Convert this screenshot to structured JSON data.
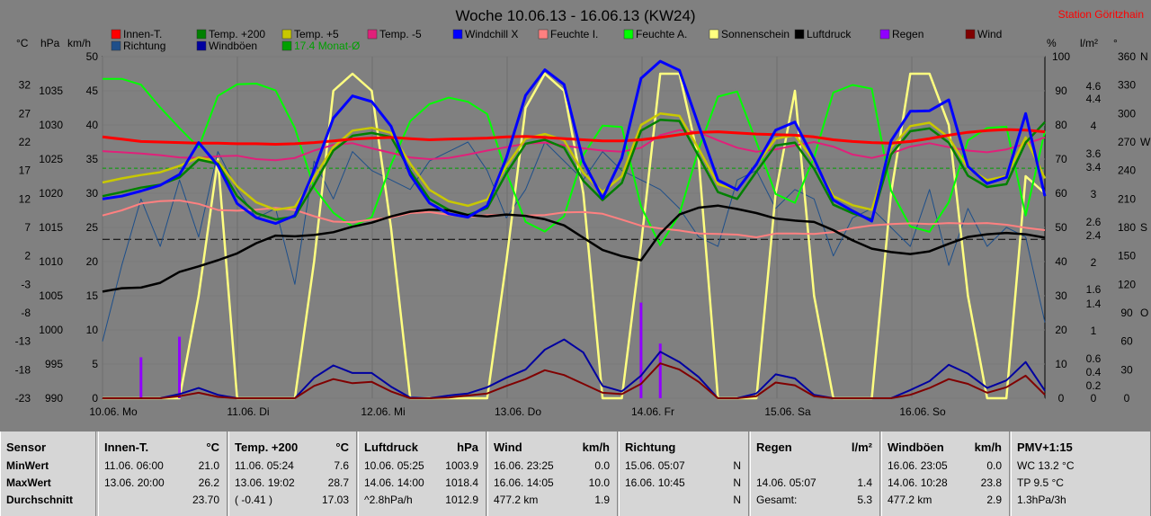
{
  "title": "Woche 10.06.13 - 16.06.13 (KW24)",
  "station": "Station Göritzhain",
  "left_axis_units": [
    "°C",
    "hPa",
    "km/h"
  ],
  "right_axis_units": [
    "%",
    "l/m²",
    "°"
  ],
  "legend": [
    {
      "label": "Innen-T.",
      "color": "#ff0000"
    },
    {
      "label": "Richtung",
      "color": "#1e4f8a"
    },
    {
      "label": "Temp. +200",
      "color": "#008000"
    },
    {
      "label": "Windböen",
      "color": "#0000a0"
    },
    {
      "label": "Temp. +5",
      "color": "#c8c800"
    },
    {
      "label": "17.4 Monat-Ø",
      "color": "#00a000"
    },
    {
      "label": "Temp. -5",
      "color": "#e0207a"
    },
    {
      "label": "Windchill X",
      "color": "#0000ff"
    },
    {
      "label": "Feuchte I.",
      "color": "#ff8080"
    },
    {
      "label": "Feuchte A.",
      "color": "#00ff00"
    },
    {
      "label": "Sonnenschein",
      "color": "#ffff80"
    },
    {
      "label": "Luftdruck",
      "color": "#000000"
    },
    {
      "label": "Regen",
      "color": "#9000ff"
    },
    {
      "label": "Wind",
      "color": "#800000"
    }
  ],
  "chart_data": {
    "type": "line",
    "title": "Woche 10.06.13 - 16.06.13 (KW24)",
    "x_labels": [
      "10.06. Mo",
      "11.06. Di",
      "12.06. Mi",
      "13.06. Do",
      "14.06. Fr",
      "15.06. Sa",
      "16.06. So"
    ],
    "axes": {
      "temp_c": {
        "ticks": [
          32.0,
          27.0,
          22.0,
          17.0,
          12.0,
          7.0,
          2.0,
          -3.0,
          -8.0,
          -13.0,
          -18.0,
          -23.0
        ],
        "range": [
          -23,
          37
        ]
      },
      "pressure_hpa": {
        "ticks": [
          1035,
          1030,
          1025,
          1020,
          1015,
          1010,
          1005,
          1000,
          995,
          990
        ],
        "range": [
          990,
          1040
        ]
      },
      "wind_kmh": {
        "ticks": [
          50.0,
          45.0,
          40.0,
          35.0,
          30.0,
          25.0,
          20.0,
          15.0,
          10.0,
          5.0,
          0.0
        ],
        "range": [
          0,
          50
        ]
      },
      "humidity_pct": {
        "ticks": [
          100,
          90,
          80,
          70,
          60,
          50,
          40,
          30,
          20,
          10,
          0
        ],
        "range": [
          0,
          100
        ]
      },
      "rain_lm2": {
        "ticks": [
          4.6,
          4.4,
          4.0,
          3.6,
          3.4,
          3.0,
          2.6,
          2.4,
          2.0,
          1.6,
          1.4,
          1.0,
          0.6,
          0.4,
          0.2,
          0.0
        ]
      },
      "direction_deg": {
        "ticks": [
          360,
          330,
          300,
          270,
          240,
          210,
          180,
          150,
          120,
          90,
          60,
          30,
          0
        ],
        "compass": [
          {
            "deg": 360,
            "label": "N"
          },
          {
            "deg": 270,
            "label": "W"
          },
          {
            "deg": 180,
            "label": "S"
          },
          {
            "deg": 90,
            "label": "O"
          }
        ]
      }
    },
    "monthly_mean_temp": 17.4,
    "series": [
      {
        "name": "Innen-T.",
        "axis": "temp_c",
        "values": [
          22.9,
          22.5,
          22.1,
          22.0,
          21.9,
          21.8,
          21.8,
          21.7,
          21.7,
          21.6,
          21.7,
          21.9,
          22.2,
          22.5,
          22.7,
          22.8,
          22.6,
          22.4,
          22.5,
          22.6,
          22.7,
          22.9,
          23.0,
          22.8,
          22.6,
          22.4,
          22.2,
          22.2,
          22.4,
          22.8,
          23.3,
          23.7,
          23.8,
          23.6,
          23.4,
          23.3,
          23.2,
          22.9,
          22.4,
          22.1,
          21.9,
          21.8,
          22.1,
          22.6,
          23.2,
          23.7,
          24.0,
          24.2,
          24.1,
          23.8
        ]
      },
      {
        "name": "Temp. +200",
        "axis": "temp_c",
        "values": [
          12.5,
          13.2,
          14.0,
          14.5,
          15.8,
          18.9,
          18.2,
          12.5,
          9.5,
          8.4,
          8.9,
          14.5,
          20.5,
          23.1,
          23.6,
          22.9,
          16.9,
          12.0,
          10.1,
          9.2,
          10.4,
          16.5,
          21.7,
          22.4,
          21.0,
          15.2,
          11.8,
          14.8,
          24.0,
          25.9,
          25.7,
          19.5,
          13.2,
          12.0,
          16.8,
          21.4,
          21.9,
          17.3,
          11.0,
          9.5,
          8.4,
          19.8,
          23.9,
          24.4,
          21.9,
          16.1,
          14.1,
          14.6,
          21.9,
          25.5
        ]
      },
      {
        "name": "Temp. +5",
        "axis": "temp_c",
        "values": [
          14.9,
          15.6,
          16.2,
          16.7,
          17.8,
          19.3,
          18.6,
          14.2,
          11.4,
          10.1,
          10.6,
          15.8,
          21.1,
          24.0,
          24.5,
          23.6,
          18.2,
          13.6,
          11.6,
          10.8,
          11.9,
          17.8,
          22.6,
          23.4,
          22.3,
          16.6,
          13.2,
          16.0,
          25.0,
          27.0,
          26.6,
          20.8,
          14.6,
          13.6,
          18.1,
          22.6,
          23.2,
          18.7,
          12.5,
          10.9,
          10.1,
          21.0,
          24.8,
          25.4,
          22.8,
          17.4,
          15.3,
          16.0,
          22.8,
          15.6
        ]
      },
      {
        "name": "Temp. -5",
        "axis": "temp_c",
        "values": [
          20.4,
          20.2,
          20.0,
          19.7,
          19.3,
          19.2,
          19.5,
          19.6,
          19.0,
          18.8,
          19.2,
          20.5,
          21.5,
          21.8,
          20.9,
          20.1,
          19.3,
          19.0,
          19.2,
          19.8,
          20.5,
          21.1,
          21.7,
          21.9,
          21.4,
          20.9,
          20.5,
          20.3,
          21.0,
          23.2,
          24.1,
          23.7,
          22.3,
          21.0,
          20.3,
          20.7,
          21.4,
          22.0,
          21.2,
          19.8,
          19.2,
          20.0,
          21.2,
          21.8,
          21.1,
          20.5,
          20.2,
          20.7,
          21.7,
          22.8
        ]
      },
      {
        "name": "Windchill X",
        "axis": "temp_c",
        "values": [
          12.0,
          12.5,
          13.4,
          14.4,
          16.3,
          21.9,
          17.9,
          11.2,
          8.7,
          7.7,
          9.1,
          17.0,
          26.2,
          30.1,
          29.1,
          24.8,
          16.2,
          11.3,
          9.4,
          8.8,
          10.8,
          19.2,
          30.2,
          34.7,
          32.1,
          18.6,
          12.1,
          19.2,
          33.2,
          36.2,
          34.6,
          24.9,
          15.3,
          13.6,
          18.1,
          24.1,
          25.5,
          19.0,
          11.8,
          9.9,
          8.1,
          22.2,
          27.4,
          27.5,
          29.4,
          17.7,
          14.7,
          15.8,
          27.0,
          12.5
        ]
      },
      {
        "name": "Feuchte I.",
        "axis": "humidity_pct",
        "values": [
          53.5,
          55.0,
          57.0,
          57.7,
          57.9,
          56.9,
          55.1,
          54.9,
          55.2,
          55.7,
          55.1,
          53.3,
          51.7,
          51.5,
          52.3,
          52.9,
          54.2,
          54.5,
          53.7,
          53.1,
          53.6,
          53.7,
          53.5,
          53.6,
          54.4,
          54.5,
          54.0,
          52.3,
          50.5,
          49.7,
          49.1,
          48.2,
          48.1,
          47.9,
          47.1,
          48.2,
          48.2,
          48.1,
          48.6,
          49.8,
          50.6,
          51.0,
          51.2,
          51.0,
          51.3,
          51.1,
          51.3,
          50.8,
          49.9,
          49.2
        ]
      },
      {
        "name": "Feuchte A.",
        "axis": "humidity_pct",
        "values": [
          93.5,
          93.5,
          91.8,
          85.1,
          79.1,
          73.4,
          88.5,
          91.9,
          92.1,
          90.1,
          79.1,
          61.6,
          54.3,
          50.3,
          53.0,
          68.4,
          81.1,
          86.1,
          88.0,
          86.8,
          83.2,
          66.1,
          51.6,
          48.8,
          53.3,
          71.2,
          79.8,
          79.4,
          56.1,
          44.8,
          53.9,
          73.0,
          88.3,
          89.8,
          75.0,
          59.8,
          57.2,
          70.5,
          89.5,
          91.7,
          90.6,
          60.8,
          50.3,
          48.7,
          57.4,
          75.5,
          79.1,
          79.5,
          53.5,
          78.2
        ]
      },
      {
        "name": "Luftdruck",
        "axis": "pressure_hpa",
        "values": [
          1005.6,
          1006.1,
          1006.2,
          1006.9,
          1008.5,
          1009.3,
          1010.2,
          1011.2,
          1012.7,
          1013.8,
          1013.7,
          1013.9,
          1014.3,
          1015.1,
          1015.7,
          1016.6,
          1017.3,
          1017.6,
          1017.5,
          1016.8,
          1016.6,
          1016.9,
          1016.7,
          1016.2,
          1015.3,
          1013.5,
          1011.7,
          1010.8,
          1010.2,
          1014.1,
          1016.9,
          1017.9,
          1018.2,
          1017.7,
          1017.1,
          1016.3,
          1016.0,
          1015.8,
          1014.6,
          1013.1,
          1011.9,
          1011.4,
          1011.1,
          1011.5,
          1012.6,
          1013.6,
          1014.0,
          1014.2,
          1014.0,
          1013.5
        ]
      },
      {
        "name": "Windböen",
        "axis": "wind_kmh",
        "values": [
          0.0,
          0.0,
          0.0,
          0.0,
          0.6,
          1.5,
          0.5,
          0.0,
          0.0,
          0.0,
          0.0,
          3.0,
          4.8,
          3.7,
          3.7,
          1.7,
          0.1,
          0.0,
          0.4,
          0.7,
          1.6,
          3.0,
          4.2,
          7.1,
          8.6,
          6.7,
          1.8,
          1.0,
          3.3,
          6.8,
          5.3,
          3.1,
          0.0,
          0.0,
          0.7,
          3.5,
          2.9,
          0.5,
          0.0,
          0.0,
          0.0,
          0.0,
          1.2,
          2.5,
          4.9,
          3.6,
          1.5,
          2.6,
          5.3,
          1.1
        ]
      },
      {
        "name": "Wind",
        "axis": "wind_kmh",
        "values": [
          0.0,
          0.0,
          0.0,
          0.0,
          0.3,
          0.8,
          0.2,
          0.0,
          0.0,
          0.0,
          0.0,
          1.8,
          2.8,
          2.2,
          2.4,
          1.0,
          0.0,
          0.0,
          0.1,
          0.4,
          0.7,
          1.8,
          2.8,
          4.1,
          3.4,
          2.1,
          0.8,
          0.6,
          2.1,
          5.1,
          4.2,
          2.4,
          0.0,
          0.0,
          0.3,
          2.3,
          1.9,
          0.3,
          0.0,
          0.0,
          0.0,
          0.0,
          0.5,
          1.5,
          2.8,
          2.1,
          0.8,
          1.6,
          3.3,
          0.5
        ]
      },
      {
        "name": "Sonnenschein",
        "axis": "humidity_pct",
        "values": [
          0,
          0,
          0,
          0,
          0,
          30,
          70,
          0,
          0,
          0,
          0,
          40,
          90,
          95,
          90,
          50,
          0,
          0,
          0,
          0,
          0,
          40,
          85,
          95,
          90,
          60,
          0,
          0,
          45,
          95,
          95,
          70,
          0,
          0,
          0,
          60,
          90,
          30,
          0,
          0,
          0,
          60,
          95,
          95,
          80,
          30,
          0,
          0,
          65,
          60
        ]
      },
      {
        "name": "Richtung",
        "axis": "direction_deg",
        "values": [
          60,
          140,
          210,
          160,
          230,
          170,
          260,
          220,
          190,
          200,
          120,
          250,
          210,
          260,
          240,
          230,
          220,
          250,
          260,
          270,
          240,
          190,
          220,
          270,
          250,
          230,
          260,
          240,
          230,
          220,
          200,
          170,
          160,
          230,
          240,
          200,
          220,
          210,
          150,
          190,
          200,
          180,
          160,
          220,
          140,
          200,
          160,
          180,
          170,
          80
        ]
      },
      {
        "name": "Regen",
        "axis": "rain_lm2",
        "values": [
          0,
          0,
          0.6,
          0,
          0.9,
          0,
          0,
          0,
          0,
          0,
          0,
          0,
          0,
          0,
          0,
          0,
          0,
          0,
          0,
          0,
          0,
          0,
          0,
          0,
          0,
          0,
          0,
          0,
          1.4,
          0.8,
          0,
          0,
          0,
          0,
          0,
          0,
          0,
          0,
          0,
          0,
          0,
          0,
          0,
          0,
          0,
          0,
          0,
          0,
          0,
          0
        ]
      }
    ]
  },
  "stats": {
    "labels": {
      "header": "Sensor",
      "rows": [
        "MinWert",
        "MaxWert",
        "Durchschnitt"
      ]
    },
    "panels": [
      {
        "header": "Innen-T.",
        "unit": "°C",
        "rows": [
          [
            "11.06. 06:00",
            "21.0"
          ],
          [
            "13.06. 20:00",
            "26.2"
          ],
          [
            "",
            "23.70"
          ]
        ]
      },
      {
        "header": "Temp. +200",
        "unit": "°C",
        "rows": [
          [
            "11.06. 05:24",
            "7.6"
          ],
          [
            "13.06. 19:02",
            "28.7"
          ],
          [
            "( -0.41 )",
            "17.03"
          ]
        ]
      },
      {
        "header": "Luftdruck",
        "unit": "hPa",
        "rows": [
          [
            "10.06. 05:25",
            "1003.9"
          ],
          [
            "14.06. 14:00",
            "1018.4"
          ],
          [
            "^2.8hPa/h",
            "1012.9"
          ]
        ]
      },
      {
        "header": "Wind",
        "unit": "km/h",
        "rows": [
          [
            "16.06. 23:25",
            "0.0"
          ],
          [
            "16.06. 14:05",
            "10.0"
          ],
          [
            "477.2 km",
            "1.9"
          ]
        ]
      },
      {
        "header": "Richtung",
        "unit": "",
        "rows": [
          [
            "15.06. 05:07",
            "N"
          ],
          [
            "16.06. 10:45",
            "N"
          ],
          [
            "",
            "N"
          ]
        ]
      },
      {
        "header": "Regen",
        "unit": "l/m²",
        "rows": [
          [
            "",
            ""
          ],
          [
            "14.06. 05:07",
            "1.4"
          ],
          [
            "Gesamt:",
            "5.3"
          ]
        ]
      },
      {
        "header": "Windböen",
        "unit": "km/h",
        "rows": [
          [
            "16.06. 23:05",
            "0.0"
          ],
          [
            "14.06. 10:28",
            "23.8"
          ],
          [
            "477.2 km",
            "2.9"
          ]
        ]
      },
      {
        "header": "PMV+1:15",
        "unit": "",
        "rows": [
          [
            "WC 13.2 °C",
            ""
          ],
          [
            "TP 9.5 °C",
            ""
          ],
          [
            "1.3hPa/3h",
            ""
          ]
        ]
      }
    ]
  }
}
